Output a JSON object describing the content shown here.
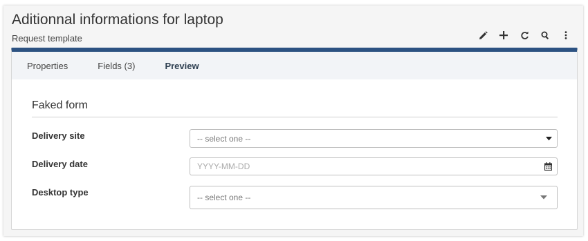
{
  "header": {
    "title": "Aditionnal informations for laptop",
    "subtitle": "Request template"
  },
  "toolbar": {
    "icons": [
      "pencil-icon",
      "plus-icon",
      "refresh-icon",
      "search-icon",
      "more-vertical-icon"
    ]
  },
  "tabs": [
    {
      "label": "Properties",
      "active": false
    },
    {
      "label": "Fields (3)",
      "active": false
    },
    {
      "label": "Preview",
      "active": true
    }
  ],
  "form": {
    "legend": "Faked form",
    "fields": [
      {
        "label": "Delivery site",
        "type": "select",
        "value": "-- select one --"
      },
      {
        "label": "Delivery date",
        "type": "date",
        "placeholder": "YYYY-MM-DD"
      },
      {
        "label": "Desktop type",
        "type": "select",
        "value": "-- select one --"
      }
    ]
  },
  "colors": {
    "accent": "#2c5282",
    "tab_bar": "#f2f4f7",
    "page_bg": "#f5f5f5"
  }
}
